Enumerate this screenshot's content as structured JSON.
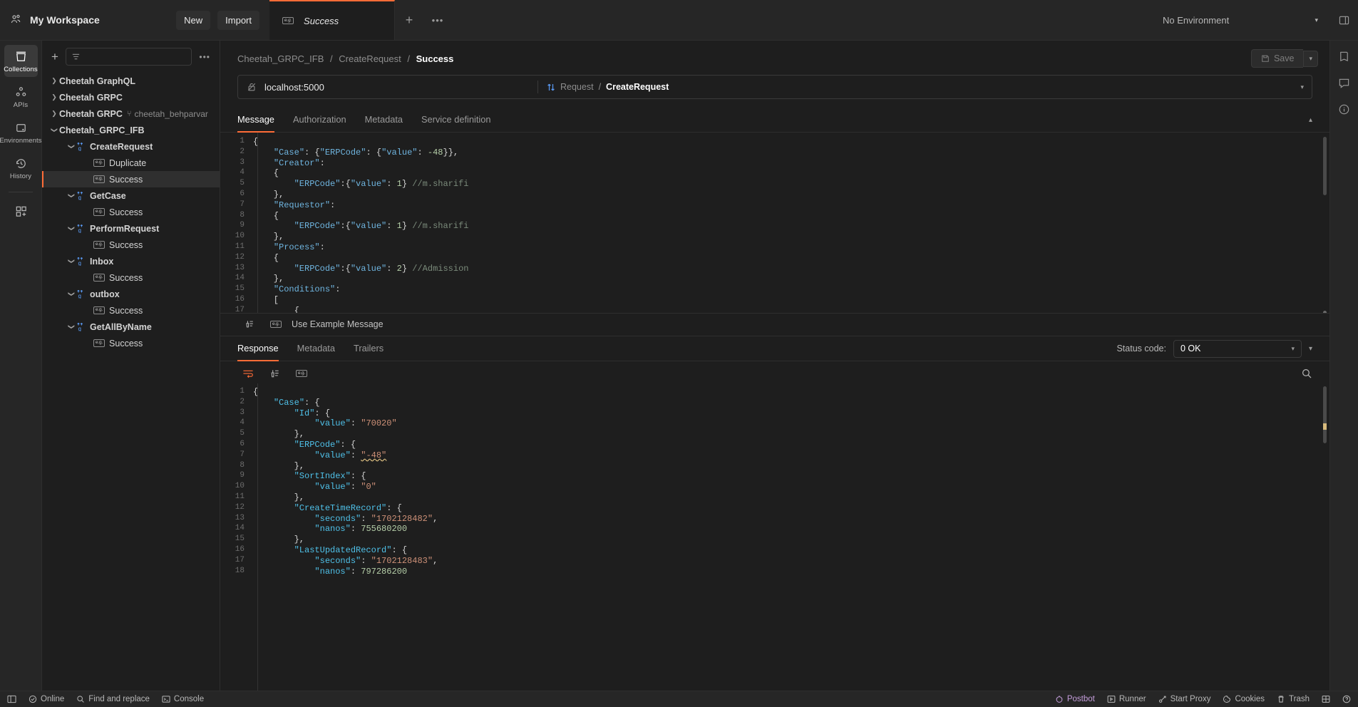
{
  "topbar": {
    "workspace_icon": "users-icon",
    "workspace": "My Workspace",
    "new_label": "New",
    "import_label": "Import",
    "tab": {
      "icon": "example-icon",
      "label": "Success"
    },
    "new_tab_icon": "plus-icon",
    "tab_menu_icon": "ellipsis-icon",
    "environment": "No Environment",
    "env_caret_icon": "chevron-down-icon",
    "layout_icon": "layout-icon"
  },
  "rail": {
    "items": [
      {
        "icon": "collections-icon",
        "label": "Collections",
        "active": true
      },
      {
        "icon": "apis-icon",
        "label": "APIs",
        "active": false
      },
      {
        "icon": "environments-icon",
        "label": "Environments",
        "active": false
      },
      {
        "icon": "history-icon",
        "label": "History",
        "active": false
      }
    ],
    "add_module": {
      "icon": "add-module-icon",
      "label": ""
    }
  },
  "sidebar": {
    "add_icon": "plus-icon",
    "filter_icon": "filter-icon",
    "more_icon": "ellipsis-icon",
    "tree": [
      {
        "label": "Cheetah GraphQL",
        "level": 0,
        "kind": "collection",
        "caret": "collapsed",
        "selected": false
      },
      {
        "label": "Cheetah GRPC",
        "level": 0,
        "kind": "collection",
        "caret": "collapsed",
        "selected": false
      },
      {
        "label": "Cheetah GRPC",
        "level": 0,
        "kind": "collection",
        "caret": "collapsed",
        "selected": false,
        "fork": "cheetah_behparvar"
      },
      {
        "label": "Cheetah_GRPC_IFB",
        "level": 0,
        "kind": "collection",
        "caret": "expanded",
        "selected": false
      },
      {
        "label": "CreateRequest",
        "level": 1,
        "kind": "grpc",
        "caret": "expanded",
        "selected": false
      },
      {
        "label": "Duplicate",
        "level": 2,
        "kind": "example",
        "caret": "none",
        "selected": false
      },
      {
        "label": "Success",
        "level": 2,
        "kind": "example",
        "caret": "none",
        "selected": true
      },
      {
        "label": "GetCase",
        "level": 1,
        "kind": "grpc",
        "caret": "expanded",
        "selected": false
      },
      {
        "label": "Success",
        "level": 2,
        "kind": "example",
        "caret": "none",
        "selected": false
      },
      {
        "label": "PerformRequest",
        "level": 1,
        "kind": "grpc",
        "caret": "expanded",
        "selected": false
      },
      {
        "label": "Success",
        "level": 2,
        "kind": "example",
        "caret": "none",
        "selected": false
      },
      {
        "label": "Inbox",
        "level": 1,
        "kind": "grpc",
        "caret": "expanded",
        "selected": false
      },
      {
        "label": "Success",
        "level": 2,
        "kind": "example",
        "caret": "none",
        "selected": false
      },
      {
        "label": "outbox",
        "level": 1,
        "kind": "grpc",
        "caret": "expanded",
        "selected": false
      },
      {
        "label": "Success",
        "level": 2,
        "kind": "example",
        "caret": "none",
        "selected": false
      },
      {
        "label": "GetAllByName",
        "level": 1,
        "kind": "grpc",
        "caret": "expanded",
        "selected": false
      },
      {
        "label": "Success",
        "level": 2,
        "kind": "example",
        "caret": "none",
        "selected": false
      }
    ]
  },
  "main": {
    "breadcrumb": {
      "collection": "Cheetah_GRPC_IFB",
      "method": "CreateRequest",
      "current": "Success",
      "separator": "/"
    },
    "save_label": "Save",
    "save_icon": "save-icon",
    "save_caret_icon": "chevron-down-icon",
    "url": {
      "lock_icon": "unlocked-icon",
      "value": "localhost:5000",
      "method_icon": "bidirectional-arrows-icon",
      "method_prefix": "Request",
      "method_sep": "/",
      "method_name": "CreateRequest",
      "caret_icon": "chevron-down-icon"
    },
    "request_tabs": [
      {
        "label": "Message",
        "active": true
      },
      {
        "label": "Authorization",
        "active": false
      },
      {
        "label": "Metadata",
        "active": false
      },
      {
        "label": "Service definition",
        "active": false
      }
    ],
    "collapse_icon": "chevron-up-icon",
    "message_body": [
      {
        "n": 1,
        "tokens": [
          {
            "t": "{",
            "c": "p"
          }
        ]
      },
      {
        "n": 2,
        "tokens": [
          {
            "t": "    ",
            "c": "p"
          },
          {
            "t": "\"Case\"",
            "c": "k"
          },
          {
            "t": ": {",
            "c": "p"
          },
          {
            "t": "\"ERPCode\"",
            "c": "k"
          },
          {
            "t": ": {",
            "c": "p"
          },
          {
            "t": "\"value\"",
            "c": "k"
          },
          {
            "t": ": ",
            "c": "p"
          },
          {
            "t": "-48",
            "c": "n"
          },
          {
            "t": "}},",
            "c": "p"
          }
        ]
      },
      {
        "n": 3,
        "tokens": [
          {
            "t": "    ",
            "c": "p"
          },
          {
            "t": "\"Creator\"",
            "c": "k"
          },
          {
            "t": ":",
            "c": "p"
          }
        ]
      },
      {
        "n": 4,
        "tokens": [
          {
            "t": "    {",
            "c": "p"
          }
        ]
      },
      {
        "n": 5,
        "tokens": [
          {
            "t": "        ",
            "c": "p"
          },
          {
            "t": "\"ERPCode\"",
            "c": "k"
          },
          {
            "t": ":{",
            "c": "p"
          },
          {
            "t": "\"value\"",
            "c": "k"
          },
          {
            "t": ": ",
            "c": "p"
          },
          {
            "t": "1",
            "c": "n"
          },
          {
            "t": "} ",
            "c": "p"
          },
          {
            "t": "//m.sharifi",
            "c": "c"
          }
        ]
      },
      {
        "n": 6,
        "tokens": [
          {
            "t": "    },",
            "c": "p"
          }
        ]
      },
      {
        "n": 7,
        "tokens": [
          {
            "t": "    ",
            "c": "p"
          },
          {
            "t": "\"Requestor\"",
            "c": "k"
          },
          {
            "t": ":",
            "c": "p"
          }
        ]
      },
      {
        "n": 8,
        "tokens": [
          {
            "t": "    {",
            "c": "p"
          }
        ]
      },
      {
        "n": 9,
        "tokens": [
          {
            "t": "        ",
            "c": "p"
          },
          {
            "t": "\"ERPCode\"",
            "c": "k"
          },
          {
            "t": ":{",
            "c": "p"
          },
          {
            "t": "\"value\"",
            "c": "k"
          },
          {
            "t": ": ",
            "c": "p"
          },
          {
            "t": "1",
            "c": "n"
          },
          {
            "t": "} ",
            "c": "p"
          },
          {
            "t": "//m.sharifi",
            "c": "c"
          }
        ]
      },
      {
        "n": 10,
        "tokens": [
          {
            "t": "    },",
            "c": "p"
          }
        ]
      },
      {
        "n": 11,
        "tokens": [
          {
            "t": "    ",
            "c": "p"
          },
          {
            "t": "\"Process\"",
            "c": "k"
          },
          {
            "t": ":",
            "c": "p"
          }
        ]
      },
      {
        "n": 12,
        "tokens": [
          {
            "t": "    {",
            "c": "p"
          }
        ]
      },
      {
        "n": 13,
        "tokens": [
          {
            "t": "        ",
            "c": "p"
          },
          {
            "t": "\"ERPCode\"",
            "c": "k"
          },
          {
            "t": ":{",
            "c": "p"
          },
          {
            "t": "\"value\"",
            "c": "k"
          },
          {
            "t": ": ",
            "c": "p"
          },
          {
            "t": "2",
            "c": "n"
          },
          {
            "t": "} ",
            "c": "p"
          },
          {
            "t": "//Admission",
            "c": "c"
          }
        ]
      },
      {
        "n": 14,
        "tokens": [
          {
            "t": "    },",
            "c": "p"
          }
        ]
      },
      {
        "n": 15,
        "tokens": [
          {
            "t": "    ",
            "c": "p"
          },
          {
            "t": "\"Conditions\"",
            "c": "k"
          },
          {
            "t": ":",
            "c": "p"
          }
        ]
      },
      {
        "n": 16,
        "tokens": [
          {
            "t": "    [",
            "c": "p"
          }
        ]
      },
      {
        "n": 17,
        "tokens": [
          {
            "t": "        {",
            "c": "p"
          }
        ]
      }
    ],
    "message_footer": {
      "beautify_icon": "beautify-icon",
      "example_icon": "example-icon",
      "use_example_label": "Use Example Message"
    },
    "response_tabs": [
      {
        "label": "Response",
        "active": true
      },
      {
        "label": "Metadata",
        "active": false
      },
      {
        "label": "Trailers",
        "active": false
      }
    ],
    "status": {
      "label": "Status code:",
      "value": "0 OK",
      "caret_icon": "chevron-down-icon"
    },
    "response_collapse_icon": "chevron-down-icon",
    "response_toolbar": {
      "wrap_icon": "word-wrap-icon",
      "beautify_icon": "beautify-icon",
      "example_icon": "example-icon",
      "search_icon": "search-icon"
    },
    "response_body": [
      {
        "n": 1,
        "tokens": [
          {
            "t": "{",
            "c": "p"
          }
        ]
      },
      {
        "n": 2,
        "tokens": [
          {
            "t": "    ",
            "c": "p"
          },
          {
            "t": "\"Case\"",
            "c": "k2"
          },
          {
            "t": ": {",
            "c": "p"
          }
        ]
      },
      {
        "n": 3,
        "tokens": [
          {
            "t": "        ",
            "c": "p"
          },
          {
            "t": "\"Id\"",
            "c": "k2"
          },
          {
            "t": ": {",
            "c": "p"
          }
        ]
      },
      {
        "n": 4,
        "tokens": [
          {
            "t": "            ",
            "c": "p"
          },
          {
            "t": "\"value\"",
            "c": "k2"
          },
          {
            "t": ": ",
            "c": "p"
          },
          {
            "t": "\"70020\"",
            "c": "s"
          }
        ]
      },
      {
        "n": 5,
        "tokens": [
          {
            "t": "        },",
            "c": "p"
          }
        ]
      },
      {
        "n": 6,
        "tokens": [
          {
            "t": "        ",
            "c": "p"
          },
          {
            "t": "\"ERPCode\"",
            "c": "k2"
          },
          {
            "t": ": {",
            "c": "p"
          }
        ]
      },
      {
        "n": 7,
        "tokens": [
          {
            "t": "            ",
            "c": "p"
          },
          {
            "t": "\"value\"",
            "c": "k2"
          },
          {
            "t": ": ",
            "c": "p"
          },
          {
            "t": "\"-48\"",
            "c": "s squig"
          }
        ]
      },
      {
        "n": 8,
        "tokens": [
          {
            "t": "        },",
            "c": "p"
          }
        ]
      },
      {
        "n": 9,
        "tokens": [
          {
            "t": "        ",
            "c": "p"
          },
          {
            "t": "\"SortIndex\"",
            "c": "k2"
          },
          {
            "t": ": {",
            "c": "p"
          }
        ]
      },
      {
        "n": 10,
        "tokens": [
          {
            "t": "            ",
            "c": "p"
          },
          {
            "t": "\"value\"",
            "c": "k2"
          },
          {
            "t": ": ",
            "c": "p"
          },
          {
            "t": "\"0\"",
            "c": "s"
          }
        ]
      },
      {
        "n": 11,
        "tokens": [
          {
            "t": "        },",
            "c": "p"
          }
        ]
      },
      {
        "n": 12,
        "tokens": [
          {
            "t": "        ",
            "c": "p"
          },
          {
            "t": "\"CreateTimeRecord\"",
            "c": "k2"
          },
          {
            "t": ": {",
            "c": "p"
          }
        ]
      },
      {
        "n": 13,
        "tokens": [
          {
            "t": "            ",
            "c": "p"
          },
          {
            "t": "\"seconds\"",
            "c": "k2"
          },
          {
            "t": ": ",
            "c": "p"
          },
          {
            "t": "\"1702128482\"",
            "c": "s"
          },
          {
            "t": ",",
            "c": "p"
          }
        ]
      },
      {
        "n": 14,
        "tokens": [
          {
            "t": "            ",
            "c": "p"
          },
          {
            "t": "\"nanos\"",
            "c": "k2"
          },
          {
            "t": ": ",
            "c": "p"
          },
          {
            "t": "755680200",
            "c": "n"
          }
        ]
      },
      {
        "n": 15,
        "tokens": [
          {
            "t": "        },",
            "c": "p"
          }
        ]
      },
      {
        "n": 16,
        "tokens": [
          {
            "t": "        ",
            "c": "p"
          },
          {
            "t": "\"LastUpdatedRecord\"",
            "c": "k2"
          },
          {
            "t": ": {",
            "c": "p"
          }
        ]
      },
      {
        "n": 17,
        "tokens": [
          {
            "t": "            ",
            "c": "p"
          },
          {
            "t": "\"seconds\"",
            "c": "k2"
          },
          {
            "t": ": ",
            "c": "p"
          },
          {
            "t": "\"1702128483\"",
            "c": "s"
          },
          {
            "t": ",",
            "c": "p"
          }
        ]
      },
      {
        "n": 18,
        "tokens": [
          {
            "t": "            ",
            "c": "p"
          },
          {
            "t": "\"nanos\"",
            "c": "k2"
          },
          {
            "t": ": ",
            "c": "p"
          },
          {
            "t": "797286200",
            "c": "n"
          }
        ]
      }
    ]
  },
  "right_rail": {
    "items": [
      {
        "icon": "documentation-icon"
      },
      {
        "icon": "comments-icon"
      },
      {
        "icon": "info-icon"
      }
    ]
  },
  "statusbar": {
    "left": [
      {
        "icon": "sidebar-toggle-icon",
        "label": ""
      },
      {
        "icon": "online-icon",
        "label": "Online"
      },
      {
        "icon": "search-icon",
        "label": "Find and replace"
      },
      {
        "icon": "console-icon",
        "label": "Console"
      }
    ],
    "right": [
      {
        "icon": "postbot-icon",
        "label": "Postbot"
      },
      {
        "icon": "runner-icon",
        "label": "Runner"
      },
      {
        "icon": "proxy-icon",
        "label": "Start Proxy"
      },
      {
        "icon": "cookies-icon",
        "label": "Cookies"
      },
      {
        "icon": "trash-icon",
        "label": "Trash"
      },
      {
        "icon": "expand-icon",
        "label": ""
      },
      {
        "icon": "help-icon",
        "label": ""
      }
    ]
  },
  "colors": {
    "accent": "#ff6c37",
    "background": "#1e1e1e",
    "panel": "#262626",
    "string": "#ce9178",
    "key": "#4fc1e9",
    "number": "#b5cea8"
  }
}
